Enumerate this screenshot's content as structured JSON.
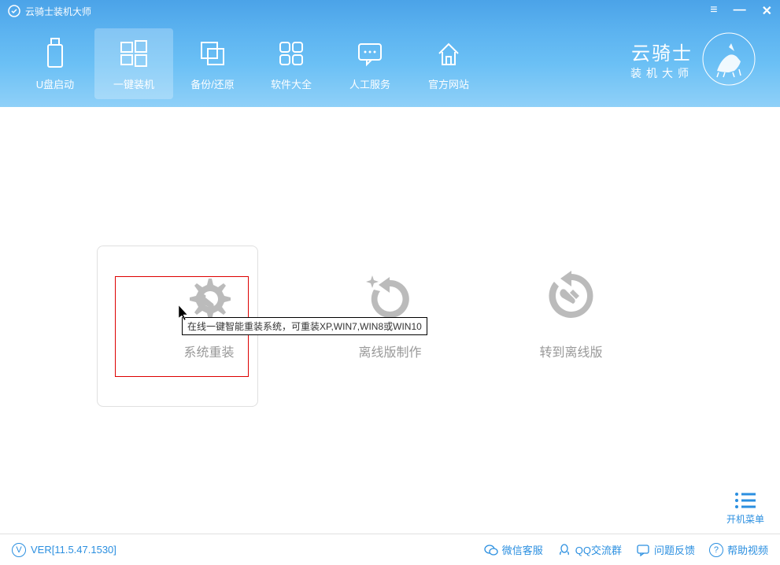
{
  "window": {
    "title": "云骑士装机大师"
  },
  "nav": {
    "items": [
      {
        "label": "U盘启动"
      },
      {
        "label": "一键装机"
      },
      {
        "label": "备份/还原"
      },
      {
        "label": "软件大全"
      },
      {
        "label": "人工服务"
      },
      {
        "label": "官方网站"
      }
    ]
  },
  "brand": {
    "title": "云骑士",
    "subtitle": "装机大师"
  },
  "options": {
    "reinstall": {
      "label": "系统重装"
    },
    "offline_make": {
      "label": "离线版制作"
    },
    "goto_offline": {
      "label": "转到离线版"
    }
  },
  "tooltip": {
    "text": "在线一键智能重装系统，可重装XP,WIN7,WIN8或WIN10"
  },
  "boot_menu": {
    "label": "开机菜单"
  },
  "footer": {
    "version": "VER[11.5.47.1530]",
    "links": {
      "wechat": "微信客服",
      "qq": "QQ交流群",
      "feedback": "问题反馈",
      "help": "帮助视频"
    }
  }
}
